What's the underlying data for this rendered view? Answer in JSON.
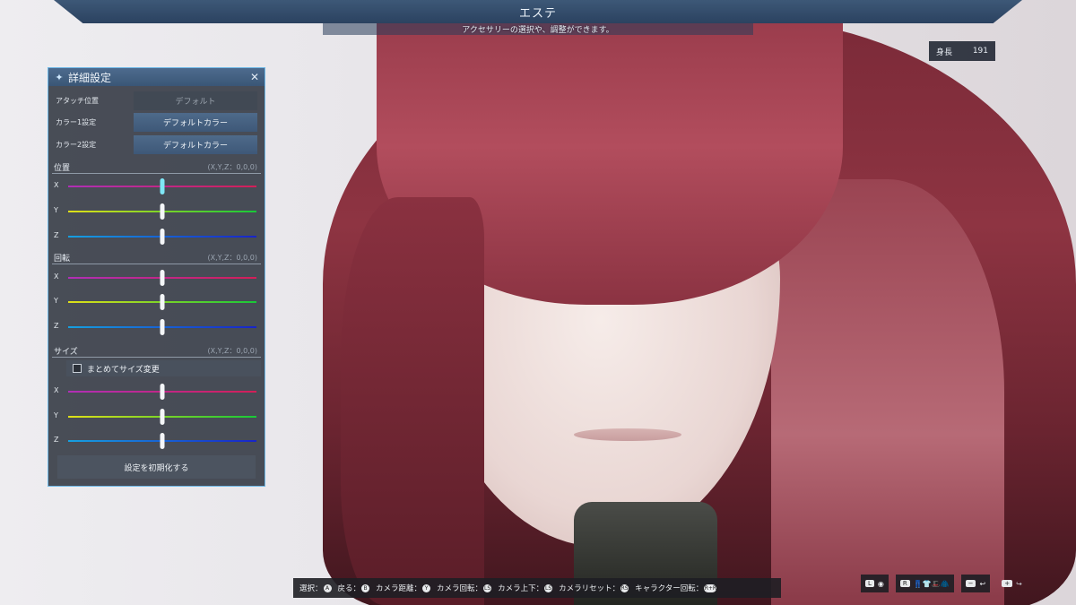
{
  "header": {
    "title": "エステ",
    "subtitle": "アクセサリーの選択や、調整ができます。"
  },
  "height_badge": {
    "label": "身長",
    "value": "191"
  },
  "panel": {
    "title": "詳細設定",
    "rows": [
      {
        "label": "アタッチ位置",
        "value": "デフォルト",
        "enabled": false
      },
      {
        "label": "カラー1設定",
        "value": "デフォルトカラー",
        "enabled": true
      },
      {
        "label": "カラー2設定",
        "value": "デフォルトカラー",
        "enabled": true
      }
    ],
    "position": {
      "label": "位置",
      "readout": "(X,Y,Z：0,0,0)",
      "sliders": [
        {
          "axis": "X",
          "value": 0.5
        },
        {
          "axis": "Y",
          "value": 0.5
        },
        {
          "axis": "Z",
          "value": 0.5
        }
      ]
    },
    "rotation": {
      "label": "回転",
      "readout": "(X,Y,Z：0,0,0)",
      "sliders": [
        {
          "axis": "X",
          "value": 0.5
        },
        {
          "axis": "Y",
          "value": 0.5
        },
        {
          "axis": "Z",
          "value": 0.5
        }
      ]
    },
    "size": {
      "label": "サイズ",
      "readout": "(X,Y,Z：0,0,0)",
      "together_label": "まとめてサイズ変更",
      "together_checked": false,
      "sliders": [
        {
          "axis": "X",
          "value": 0.5
        },
        {
          "axis": "Y",
          "value": 0.5
        },
        {
          "axis": "Z",
          "value": 0.5
        }
      ]
    },
    "reset_label": "設定を初期化する"
  },
  "hints": [
    {
      "label": "選択：",
      "button": "A"
    },
    {
      "label": "戻る：",
      "button": "B"
    },
    {
      "label": "カメラ距離：",
      "button": "Y"
    },
    {
      "label": "カメラ回転：",
      "button": "LS"
    },
    {
      "label": "カメラ上下：",
      "button": "LS"
    },
    {
      "label": "カメラリセット：",
      "button": "RS"
    },
    {
      "label": "キャラクター回転：",
      "button": "ZR+RS"
    }
  ],
  "corner_controls": [
    {
      "key": "L",
      "label": "◉"
    },
    {
      "key": "R",
      "label": "👖👕🎩🧥"
    },
    {
      "key": "−",
      "label": "↩"
    },
    {
      "key": "+",
      "label": "↪"
    }
  ],
  "colors": {
    "panel_border": "#6fb8e6",
    "header_band": "#3d5877",
    "x_track": "#d21f58",
    "y_track": "#18c838",
    "z_track": "#1824c8",
    "active_knob": "#7fe6f6"
  }
}
